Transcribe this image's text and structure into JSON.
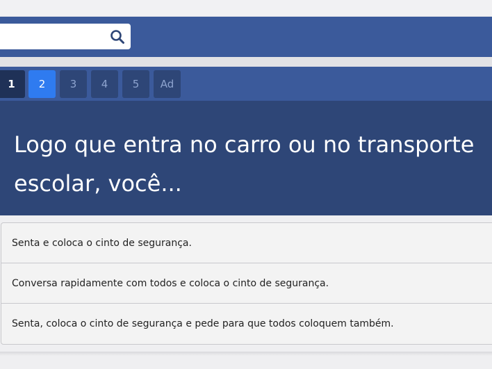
{
  "search": {
    "value": "",
    "placeholder": "",
    "icon": "search-icon"
  },
  "pager": {
    "pages": [
      {
        "label": "1",
        "state": "done"
      },
      {
        "label": "2",
        "state": "active"
      },
      {
        "label": "3",
        "state": "pending"
      },
      {
        "label": "4",
        "state": "pending"
      },
      {
        "label": "5",
        "state": "pending"
      },
      {
        "label": "Ad",
        "state": "pending"
      }
    ]
  },
  "question": {
    "text": "Logo que entra no carro ou no transporte escolar, você..."
  },
  "answers": [
    {
      "text": "Senta e coloca o cinto de segurança."
    },
    {
      "text": "Conversa rapidamente com todos e coloca o cinto de segurança."
    },
    {
      "text": "Senta, coloca o cinto de segurança e pede para que todos coloquem também."
    }
  ],
  "colors": {
    "header": "#3b5a9b",
    "question_bg": "#2e4677",
    "active_page": "#2f7bf0"
  }
}
